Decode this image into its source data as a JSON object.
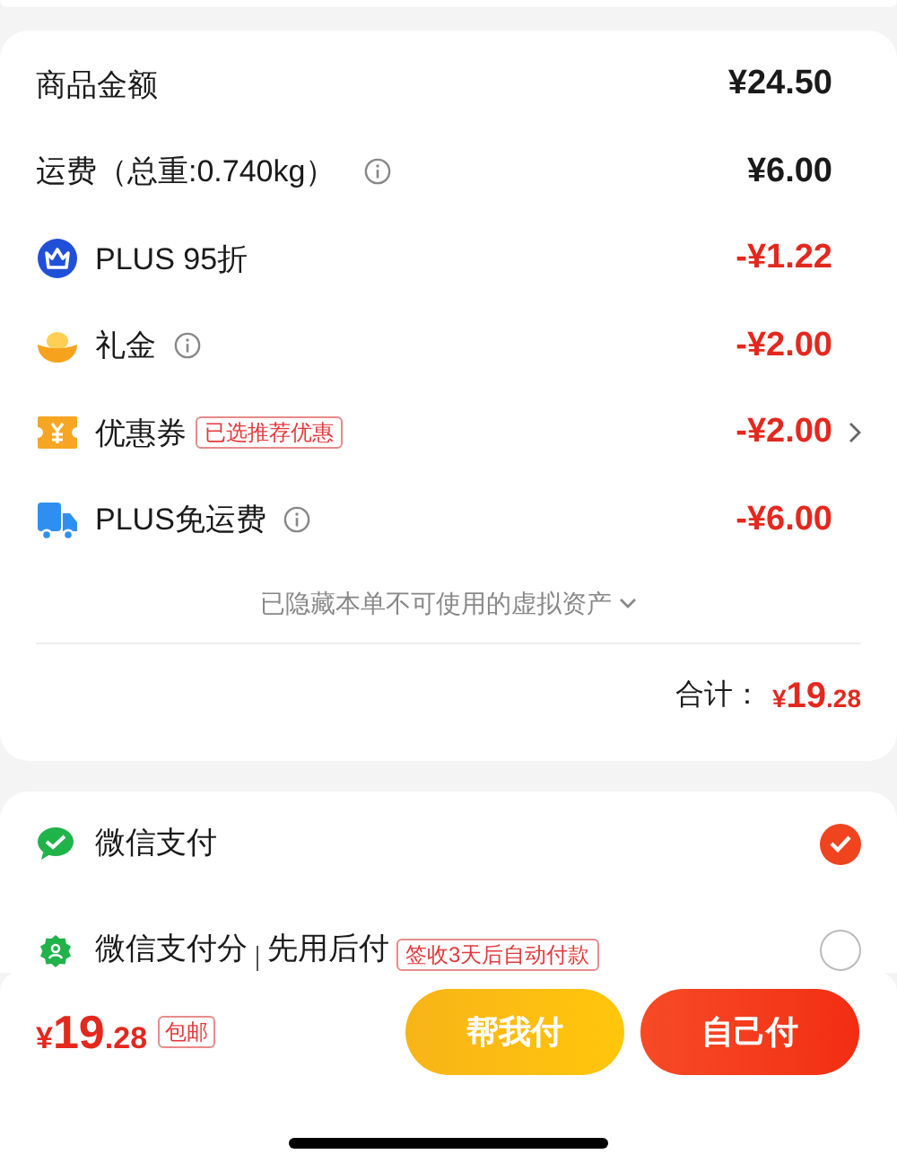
{
  "summary": {
    "rows": [
      {
        "kind": "subtotal",
        "label": "商品金额",
        "info": false,
        "amount": "¥24.50",
        "arrow": false
      },
      {
        "kind": "shipping",
        "label": "运费（总重:0.740kg）",
        "info": true,
        "amount": "¥6.00",
        "arrow": false
      },
      {
        "kind": "member",
        "label": "PLUS 95折",
        "info": false,
        "amount": "-¥1.22",
        "arrow": false
      },
      {
        "kind": "gift",
        "label": "礼金",
        "info": true,
        "amount": "-¥2.00",
        "arrow": false
      },
      {
        "kind": "coupon",
        "label": "优惠券",
        "tag": "已选推荐优惠",
        "info": false,
        "amount": "-¥2.00",
        "arrow": true
      },
      {
        "kind": "freight",
        "label": "PLUS免运费",
        "info": true,
        "amount": "-¥6.00",
        "arrow": false
      }
    ],
    "hidden_note": "已隐藏本单不可使用的虚拟资产",
    "total": {
      "label": "合计：",
      "amount_parts": [
        "¥",
        "19",
        ".28"
      ]
    }
  },
  "payment_methods": [
    {
      "kind": "wallet",
      "label": "微信支付",
      "selected": true
    },
    {
      "kind": "credit",
      "label": "微信支付分",
      "sublabel": "先用后付",
      "tag": "签收3天后自动付款",
      "selected": false
    }
  ],
  "bottom_bar": {
    "amount_parts": [
      "¥",
      "19",
      ".28"
    ],
    "badge": "包邮",
    "buttons": [
      {
        "kind": "secondary",
        "label": "帮我付"
      },
      {
        "kind": "primary",
        "label": "自己付"
      }
    ]
  }
}
